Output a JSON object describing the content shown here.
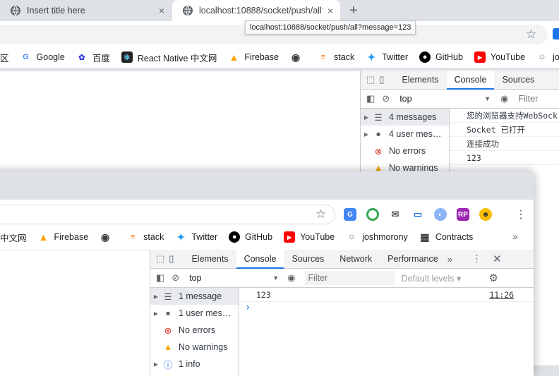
{
  "back_window": {
    "tabs": [
      {
        "title": "Insert title here",
        "close": "×"
      },
      {
        "title": "localhost:10888/socket/push/all?",
        "close": "×"
      }
    ],
    "new_tab": "+",
    "tooltip": "localhost:10888/socket/push/all?message=123",
    "bookmarks": [
      {
        "label": "区",
        "icon": "community-icon"
      },
      {
        "label": "Google",
        "icon": "google-icon"
      },
      {
        "label": "百度",
        "icon": "baidu-icon"
      },
      {
        "label": "React Native 中文网",
        "icon": "react-icon"
      },
      {
        "label": "Firebase",
        "icon": "firebase-icon"
      },
      {
        "label": "",
        "icon": "globe-icon"
      },
      {
        "label": "stack",
        "icon": "stack-icon"
      },
      {
        "label": "Twitter",
        "icon": "twitter-icon"
      },
      {
        "label": "GitHub",
        "icon": "github-icon"
      },
      {
        "label": "YouTube",
        "icon": "youtube-icon"
      },
      {
        "label": "jos",
        "icon": "avatar-icon"
      }
    ],
    "devtools": {
      "tabs": [
        "Elements",
        "Console",
        "Sources"
      ],
      "selected_tab": "Console",
      "context": "top",
      "filter_placeholder": "Filter",
      "sidebar": [
        {
          "label": "4 messages",
          "icon": "list-icon",
          "selected": true
        },
        {
          "label": "4 user mes…",
          "icon": "user-icon"
        },
        {
          "label": "No errors",
          "icon": "error-icon"
        },
        {
          "label": "No warnings",
          "icon": "warning-icon"
        }
      ],
      "logs": [
        "您的浏览器支持WebSock",
        "Socket 已打开",
        "连接成功",
        "123"
      ]
    }
  },
  "front_window": {
    "bookmarks": [
      {
        "label": "中文网",
        "icon": "react-icon"
      },
      {
        "label": "Firebase",
        "icon": "firebase-icon"
      },
      {
        "label": "",
        "icon": "globe-icon"
      },
      {
        "label": "stack",
        "icon": "stack-icon"
      },
      {
        "label": "Twitter",
        "icon": "twitter-icon"
      },
      {
        "label": "GitHub",
        "icon": "github-icon"
      },
      {
        "label": "YouTube",
        "icon": "youtube-icon"
      },
      {
        "label": "joshmorony",
        "icon": "avatar-icon"
      },
      {
        "label": "Contracts",
        "icon": "contracts-icon"
      }
    ],
    "more_bookmarks": "»",
    "devtools": {
      "tabs": [
        "Elements",
        "Console",
        "Sources",
        "Network",
        "Performance"
      ],
      "selected_tab": "Console",
      "overflow": "»",
      "context": "top",
      "filter_placeholder": "Filter",
      "levels": "Default levels ▾",
      "sidebar": [
        {
          "label": "1 message",
          "icon": "list-icon",
          "selected": true
        },
        {
          "label": "1 user mes…",
          "icon": "user-icon"
        },
        {
          "label": "No errors",
          "icon": "error-icon"
        },
        {
          "label": "No warnings",
          "icon": "warning-icon"
        },
        {
          "label": "1 info",
          "icon": "info-icon"
        }
      ],
      "log_value": "123",
      "log_time": "11:26",
      "prompt": "›"
    }
  },
  "colors": {
    "accent": "#1a73e8",
    "error": "#d93025",
    "warning": "#f9ab00",
    "youtube": "#ff0000",
    "twitter": "#1d9bf0",
    "firebase": "#ffa000"
  }
}
